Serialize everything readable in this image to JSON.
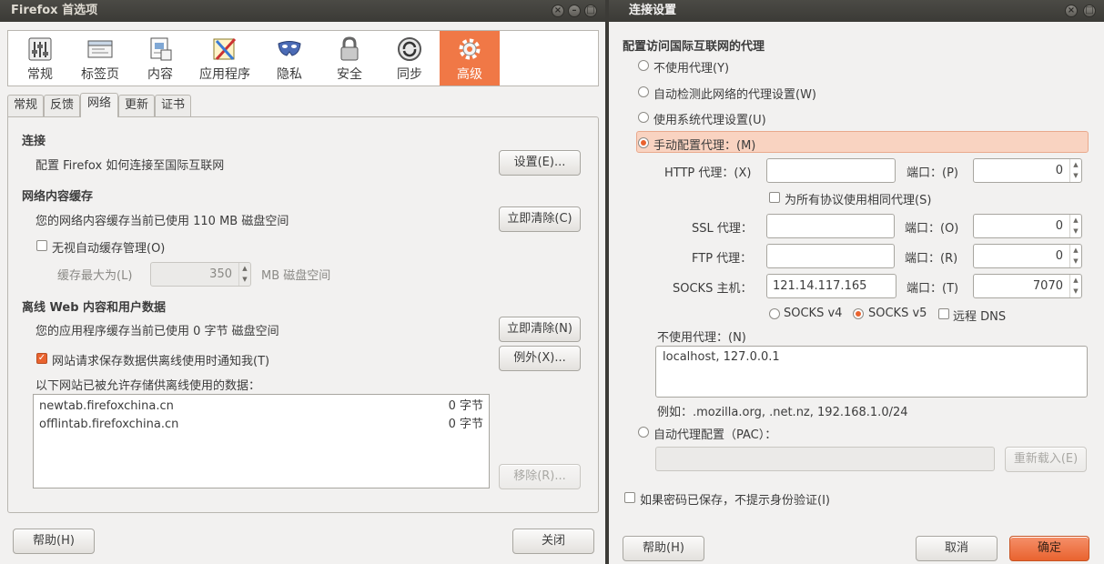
{
  "prefs": {
    "title": "Firefox 首选项",
    "toolbar": [
      {
        "label": "常规",
        "icon": "sliders-icon"
      },
      {
        "label": "标签页",
        "icon": "tabs-icon"
      },
      {
        "label": "内容",
        "icon": "content-icon"
      },
      {
        "label": "应用程序",
        "icon": "applications-icon"
      },
      {
        "label": "隐私",
        "icon": "privacy-mask-icon"
      },
      {
        "label": "安全",
        "icon": "padlock-icon"
      },
      {
        "label": "同步",
        "icon": "sync-icon"
      },
      {
        "label": "高级",
        "icon": "gear-icon"
      }
    ],
    "tabs": [
      "常规",
      "反馈",
      "网络",
      "更新",
      "证书"
    ],
    "connection": {
      "heading": "连接",
      "desc": "配置 Firefox 如何连接至国际互联网",
      "settings_btn": "设置(E)..."
    },
    "cache": {
      "heading": "网络内容缓存",
      "desc": "您的网络内容缓存当前已使用 110 MB 磁盘空间",
      "clear_btn": "立即清除(C)",
      "override_label": "无视自动缓存管理(O)",
      "limit_label": "缓存最大为(L)",
      "limit_value": "350",
      "limit_unit": "MB 磁盘空间"
    },
    "offline": {
      "heading": "离线 Web 内容和用户数据",
      "desc": "您的应用程序缓存当前已使用 0 字节 磁盘空间",
      "clear_btn": "立即清除(N)",
      "notify_label": "网站请求保存数据供离线使用时通知我(T)",
      "exceptions_btn": "例外(X)...",
      "list_label": "以下网站已被允许存储供离线使用的数据：",
      "sites": [
        {
          "host": "newtab.firefoxchina.cn",
          "size": "0 字节"
        },
        {
          "host": "offlintab.firefoxchina.cn",
          "size": "0 字节"
        }
      ],
      "remove_btn": "移除(R)..."
    },
    "help_btn": "帮助(H)",
    "close_btn": "关闭"
  },
  "conn": {
    "title": "连接设置",
    "heading": "配置访问国际互联网的代理",
    "opt_none": "不使用代理(Y)",
    "opt_autodetect": "自动检测此网络的代理设置(W)",
    "opt_system": "使用系统代理设置(U)",
    "opt_manual": "手动配置代理：(M)",
    "http_label": "HTTP 代理：(X)",
    "http_value": "",
    "port_label_http": "端口：(P)",
    "http_port": "0",
    "same_proxy_label": "为所有协议使用相同代理(S)",
    "ssl_label": "SSL 代理：",
    "ssl_value": "",
    "port_label_ssl": "端口：(O)",
    "ssl_port": "0",
    "ftp_label": "FTP 代理：",
    "ftp_value": "",
    "port_label_ftp": "端口：(R)",
    "ftp_port": "0",
    "socks_label": "SOCKS 主机：",
    "socks_value": "121.14.117.165",
    "port_label_socks": "端口：(T)",
    "socks_port": "7070",
    "socks_v4": "SOCKS v4",
    "socks_v5": "SOCKS v5",
    "remote_dns": "远程 DNS",
    "no_proxy_label": "不使用代理：(N)",
    "no_proxy_value": "localhost, 127.0.0.1",
    "example": "例如：.mozilla.org, .net.nz, 192.168.1.0/24",
    "opt_pac": "自动代理配置（PAC）：",
    "pac_value": "",
    "reload_btn": "重新载入(E)",
    "no_prompt_label": "如果密码已保存，不提示身份验证(I)",
    "help_btn": "帮助(H)",
    "cancel_btn": "取消",
    "ok_btn": "确定"
  },
  "colors": {
    "accent": "#f07846",
    "titlebar": "#3c3b37",
    "highlight": "#f9d3c1"
  }
}
